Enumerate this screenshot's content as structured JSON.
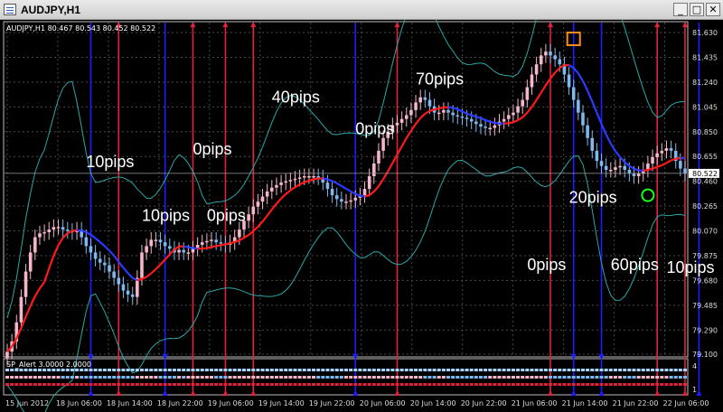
{
  "window": {
    "title": "AUDJPY,H1",
    "minimize_glyph": "_",
    "maximize_glyph": "□",
    "close_glyph": "✕"
  },
  "chart_data": {
    "type": "candlestick",
    "symbol_header": "AUDJPY,H1  80.467 80.543 80.452 80.522",
    "y_ticks": [
      "81.630",
      "81.435",
      "81.240",
      "81.045",
      "80.850",
      "80.655",
      "80.460",
      "80.265",
      "80.070",
      "79.875",
      "79.680",
      "79.485",
      "79.290",
      "79.100"
    ],
    "current_price": "80.522",
    "indicator_header": "SP_Alert 3.0000 2.0000",
    "indicator_ticks": [
      "4",
      "1"
    ],
    "x_ticks": [
      "15 Jun 2012",
      "18 Jun 06:00",
      "18 Jun 14:00",
      "18 Jun 22:00",
      "19 Jun 06:00",
      "19 Jun 14:00",
      "19 Jun 22:00",
      "20 Jun 06:00",
      "20 Jun 14:00",
      "20 Jun 22:00",
      "21 Jun 06:00",
      "21 Jun 14:00",
      "21 Jun 22:00",
      "22 Jun 06:00"
    ],
    "annotations": [
      {
        "text": "10pips",
        "x": 17,
        "y": 80.57
      },
      {
        "text": "0pips",
        "x": 40,
        "y": 80.67
      },
      {
        "text": "10pips",
        "x": 29,
        "y": 80.15
      },
      {
        "text": "0pips",
        "x": 43,
        "y": 80.15
      },
      {
        "text": "40pips",
        "x": 57,
        "y": 81.08
      },
      {
        "text": "0pips",
        "x": 75,
        "y": 80.83
      },
      {
        "text": "70pips",
        "x": 88,
        "y": 81.22
      },
      {
        "text": "20pips",
        "x": 121,
        "y": 80.29
      },
      {
        "text": "0pips",
        "x": 112,
        "y": 79.76
      },
      {
        "text": "60pips",
        "x": 130,
        "y": 79.76
      },
      {
        "text": "10pips",
        "x": 142,
        "y": 79.74
      }
    ],
    "vertical_lines": [
      {
        "x": 18,
        "color": "blue"
      },
      {
        "x": 24,
        "color": "red"
      },
      {
        "x": 34,
        "color": "blue"
      },
      {
        "x": 40,
        "color": "red"
      },
      {
        "x": 47,
        "color": "red"
      },
      {
        "x": 53,
        "color": "red"
      },
      {
        "x": 75,
        "color": "blue"
      },
      {
        "x": 84,
        "color": "red"
      },
      {
        "x": 117,
        "color": "red"
      },
      {
        "x": 122,
        "color": "blue"
      },
      {
        "x": 128,
        "color": "blue"
      },
      {
        "x": 140,
        "color": "red"
      },
      {
        "x": 146,
        "color": "red"
      },
      {
        "x": 149,
        "color": "blue"
      }
    ],
    "markers": [
      {
        "shape": "square",
        "color": "orange",
        "x": 122,
        "y": 81.58
      },
      {
        "shape": "circle",
        "color": "green",
        "x": 138,
        "y": 80.35
      }
    ],
    "closes": [
      79.12,
      79.2,
      79.35,
      79.55,
      79.75,
      79.9,
      80.02,
      80.05,
      80.06,
      80.08,
      80.1,
      80.1,
      80.08,
      80.07,
      80.06,
      80.08,
      80.02,
      79.95,
      79.9,
      79.85,
      79.82,
      79.8,
      79.75,
      79.7,
      79.65,
      79.6,
      79.57,
      79.55,
      79.7,
      79.9,
      79.95,
      80.0,
      80.0,
      79.98,
      79.95,
      79.93,
      79.9,
      79.92,
      79.9,
      79.9,
      79.93,
      79.96,
      79.98,
      79.99,
      80.0,
      79.98,
      79.97,
      79.96,
      79.98,
      80.02,
      80.08,
      80.15,
      80.2,
      80.26,
      80.3,
      80.34,
      80.38,
      80.41,
      80.43,
      80.45,
      80.46,
      80.47,
      80.48,
      80.49,
      80.5,
      80.5,
      80.5,
      80.49,
      80.45,
      80.4,
      80.35,
      80.32,
      80.3,
      80.3,
      80.31,
      80.33,
      80.35,
      80.4,
      80.5,
      80.6,
      80.7,
      80.8,
      80.85,
      80.9,
      80.92,
      80.95,
      80.98,
      81.02,
      81.08,
      81.12,
      81.1,
      81.05,
      81.0,
      81.0,
      81.02,
      81.0,
      80.98,
      80.97,
      80.96,
      80.95,
      80.93,
      80.91,
      80.89,
      80.88,
      80.88,
      80.9,
      80.93,
      80.95,
      80.98,
      81.0,
      81.05,
      81.1,
      81.2,
      81.3,
      81.38,
      81.45,
      81.48,
      81.45,
      81.42,
      81.38,
      81.3,
      81.2,
      81.1,
      81.0,
      80.9,
      80.8,
      80.7,
      80.62,
      80.58,
      80.55,
      80.55,
      80.57,
      80.58,
      80.55,
      80.52,
      80.5,
      80.52,
      80.55,
      80.6,
      80.65,
      80.68,
      80.7,
      80.72,
      80.7,
      80.62,
      80.56,
      80.52
    ]
  }
}
